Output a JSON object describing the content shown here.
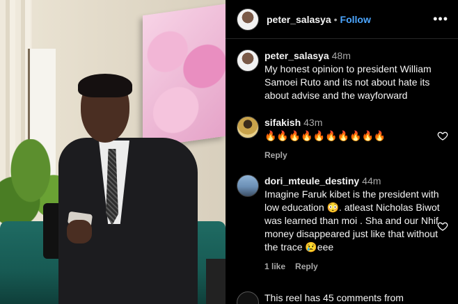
{
  "post": {
    "username": "peter_salasya",
    "separator": "•",
    "follow_label": "Follow",
    "more_label": "•••"
  },
  "caption": {
    "username": "peter_salasya",
    "time": "48m",
    "text": "My honest opinion to president William Samoei Ruto and its not about hate its about advise and the wayforward"
  },
  "comments": [
    {
      "username": "sifakish",
      "time": "43m",
      "text": "🔥🔥🔥🔥🔥🔥🔥🔥🔥🔥",
      "reply_label": "Reply"
    },
    {
      "username": "dori_mteule_destiny",
      "time": "44m",
      "text": "Imagine Faruk kibet is the president with low education 😳. atleast Nicholas Biwot was learned than moi . Sha and our Nhif money disappeared just like that without the trace 😢eee",
      "likes_label": "1 like",
      "reply_label": "Reply"
    }
  ],
  "footer": {
    "text": "This reel has 45 comments from"
  },
  "icons": {
    "heart": "heart-icon",
    "more": "more-options-icon"
  },
  "colors": {
    "background": "#000000",
    "accent": "#4ca6ff",
    "secondary_text": "#a8a8a8"
  }
}
